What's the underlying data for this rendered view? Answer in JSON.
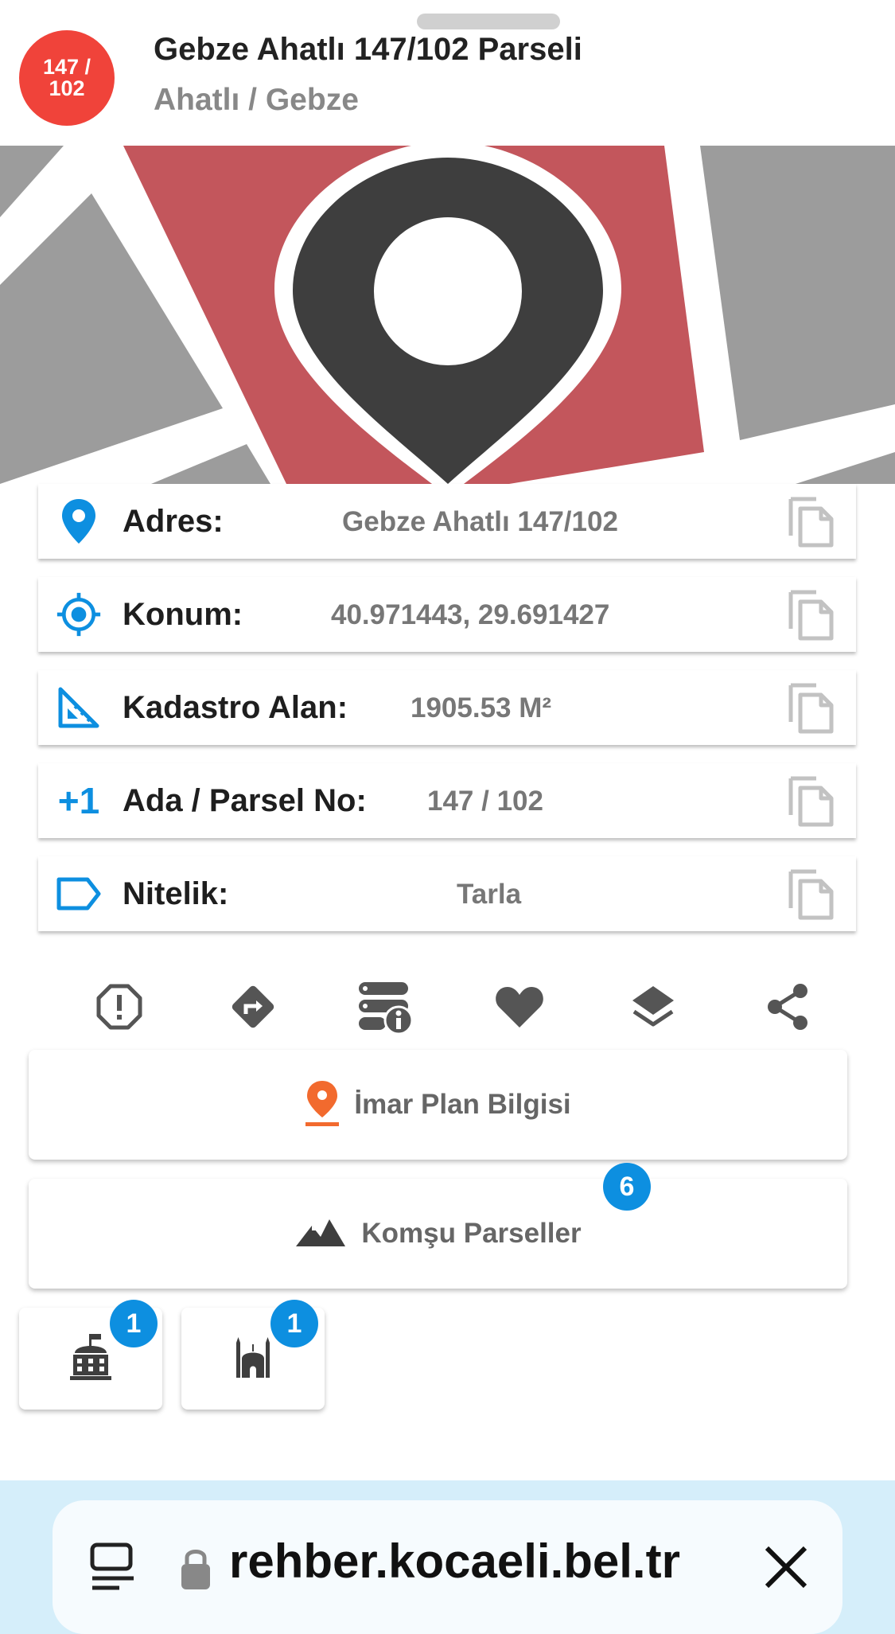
{
  "header": {
    "badge_text": "147 / 102",
    "title": "Gebze Ahatlı 147/102 Parseli",
    "subtitle": "Ahatlı / Gebze"
  },
  "info_rows": [
    {
      "label": "Adres:",
      "value": "Gebze Ahatlı 147/102",
      "icon": "location-pin-icon"
    },
    {
      "label": "Konum:",
      "value": "40.971443, 29.691427",
      "icon": "crosshair-icon"
    },
    {
      "label": "Kadastro Alan:",
      "value": "1905.53 M²",
      "icon": "set-square-icon"
    },
    {
      "label": "Ada / Parsel No:",
      "value": "147 / 102",
      "icon": "plus-one-icon",
      "icon_text": "+1"
    },
    {
      "label": "Nitelik:",
      "value": "Tarla",
      "icon": "label-tag-icon"
    }
  ],
  "actions": [
    "report-icon",
    "directions-icon",
    "server-info-icon",
    "favorite-heart-icon",
    "layers-icon",
    "share-icon"
  ],
  "buttons": {
    "imar": {
      "label": "İmar Plan Bilgisi",
      "icon": "map-pin-icon"
    },
    "komsu": {
      "label": "Komşu Parseller",
      "icon": "mountains-icon",
      "count": "6"
    }
  },
  "small_buttons": [
    {
      "icon": "government-building-icon",
      "count": "1"
    },
    {
      "icon": "mosque-icon",
      "count": "1"
    }
  ],
  "browser": {
    "url": "rehber.kocaeli.bel.tr"
  },
  "colors": {
    "accent_red": "#f0433a",
    "icon_blue": "#0d8fe0",
    "map_red": "#c3565c",
    "pin_dark": "#3e3e3e",
    "badge_blue": "#0d8fe0",
    "orange_pin": "#f26a2e"
  }
}
